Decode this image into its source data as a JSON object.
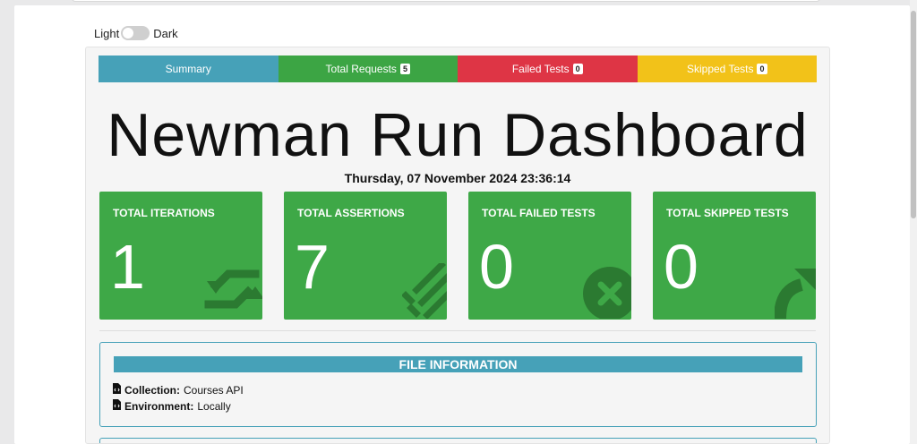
{
  "theme_toggle": {
    "light_label": "Light",
    "dark_label": "Dark",
    "state": "light"
  },
  "tabs": [
    {
      "label": "Summary",
      "count": null,
      "color": "#46a1b8"
    },
    {
      "label": "Total Requests",
      "count": "5",
      "color": "#3ca544"
    },
    {
      "label": "Failed Tests",
      "count": "0",
      "color": "#de3545"
    },
    {
      "label": "Skipped Tests",
      "count": "0",
      "color": "#f2c219"
    }
  ],
  "dashboard": {
    "title": "Newman Run Dashboard",
    "datetime": "Thursday, 07 November 2024 23:36:14"
  },
  "cards": [
    {
      "title": "TOTAL ITERATIONS",
      "value": "1",
      "icon": "repeat-icon"
    },
    {
      "title": "TOTAL ASSERTIONS",
      "value": "7",
      "icon": "list-check-icon"
    },
    {
      "title": "TOTAL FAILED TESTS",
      "value": "0",
      "icon": "times-circle-icon"
    },
    {
      "title": "TOTAL SKIPPED TESTS",
      "value": "0",
      "icon": "share-arrow-icon"
    }
  ],
  "card_color": "#3ea847",
  "file_information": {
    "header": "FILE INFORMATION",
    "collection_label": "Collection:",
    "collection_value": "Courses API",
    "environment_label": "Environment:",
    "environment_value": "Locally",
    "row_icon": "file-code-icon"
  }
}
